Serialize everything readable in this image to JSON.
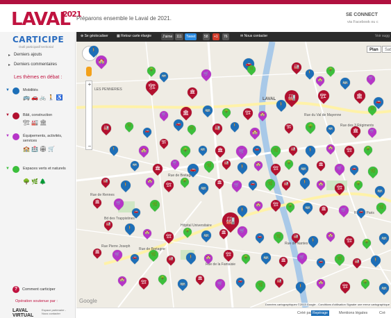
{
  "header": {
    "logo_text": "LAVAL",
    "logo_year": "2021",
    "tagline": "Préparons ensemble le Laval de 2021.",
    "connect_title": "SE CONNECT",
    "connect_sub": "via Facebook ou c"
  },
  "sidebar": {
    "brand": "CARTICIPE",
    "brand_sub": "Outil participatif territorial",
    "menu": [
      {
        "label": "Derniers ajouts"
      },
      {
        "label": "Derniers commentaires"
      }
    ],
    "themes_title": "Les thèmes en débat :",
    "themes": [
      {
        "label": "Mobilités",
        "color": "#1d6fb8",
        "icons": "🚌🚗🚲🚶♿"
      },
      {
        "label": "Bâti, construction",
        "color": "#b2102f",
        "icons": "🏗🏭🏛"
      },
      {
        "label": "Équipements, activités, services",
        "color": "#b635c8",
        "icons": "🏫🏥🏟🛒"
      },
      {
        "label": "Espaces verts et naturels",
        "color": "#3cbf3c",
        "icons": "🌳🌿🌲"
      }
    ],
    "comment_label": "Comment carticiper",
    "support_label": "Opération soutenue par :",
    "partner_name": "LAVAL VIRTUAL",
    "partner_sub": "Espace partenaire - Nous contacter"
  },
  "toolbar": {
    "geoloc": "Se géolocaliser",
    "back": "Retour carte élargie",
    "like": "J'aime",
    "like_count": "111",
    "tweet": "Tweet",
    "tweet_count": "58",
    "gplus": "+1",
    "gplus_count": "76",
    "contact": "Nous contacter",
    "view_label": "Voir sugg"
  },
  "map": {
    "type_plan": "Plan",
    "type_sat": "Sat",
    "zoom_in": "+",
    "zoom_out": "−",
    "labels": [
      {
        "text": "LES PENNERIES"
      },
      {
        "text": "LAVAL"
      },
      {
        "text": "Rue du Val de Mayenne"
      },
      {
        "text": "Rue des 3 Régiments"
      },
      {
        "text": "Rue de Bretagne"
      },
      {
        "text": "Hôpital Universitaire"
      },
      {
        "text": "Bd des Trappistines"
      },
      {
        "text": "Rue de Rennes"
      },
      {
        "text": "Rue de Nantes"
      },
      {
        "text": "Rue Pierre Joseph"
      },
      {
        "text": "Rue de la Fantaisie"
      },
      {
        "text": "Rue de Paris"
      },
      {
        "text": "Rue de Bretagne"
      }
    ],
    "google": "Google",
    "attribution": "Données cartographiques ©2013 Google - Conditions d'utilisation  Signaler une erreur cartographique",
    "markers": [
      {
        "c": "#1d6fb8",
        "g": "🚶"
      },
      {
        "c": "#b635c8",
        "g": "🏫"
      },
      {
        "c": "#b2102f",
        "g": "🏗"
      },
      {
        "c": "#3cbf3c",
        "g": "🌳"
      },
      {
        "c": "#1d6fb8",
        "g": "🚌"
      },
      {
        "c": "#b2102f",
        "g": "🏛"
      },
      {
        "c": "#b635c8",
        "g": "🛒"
      },
      {
        "c": "#1d6fb8",
        "g": "🚗"
      },
      {
        "c": "#3cbf3c",
        "g": "🌿"
      },
      {
        "c": "#b2102f",
        "g": "🏭"
      }
    ]
  },
  "footer": {
    "created_by": "Créé par",
    "created_badge": "Repérage",
    "legal": "Mentions légales",
    "credits": "Cré"
  }
}
